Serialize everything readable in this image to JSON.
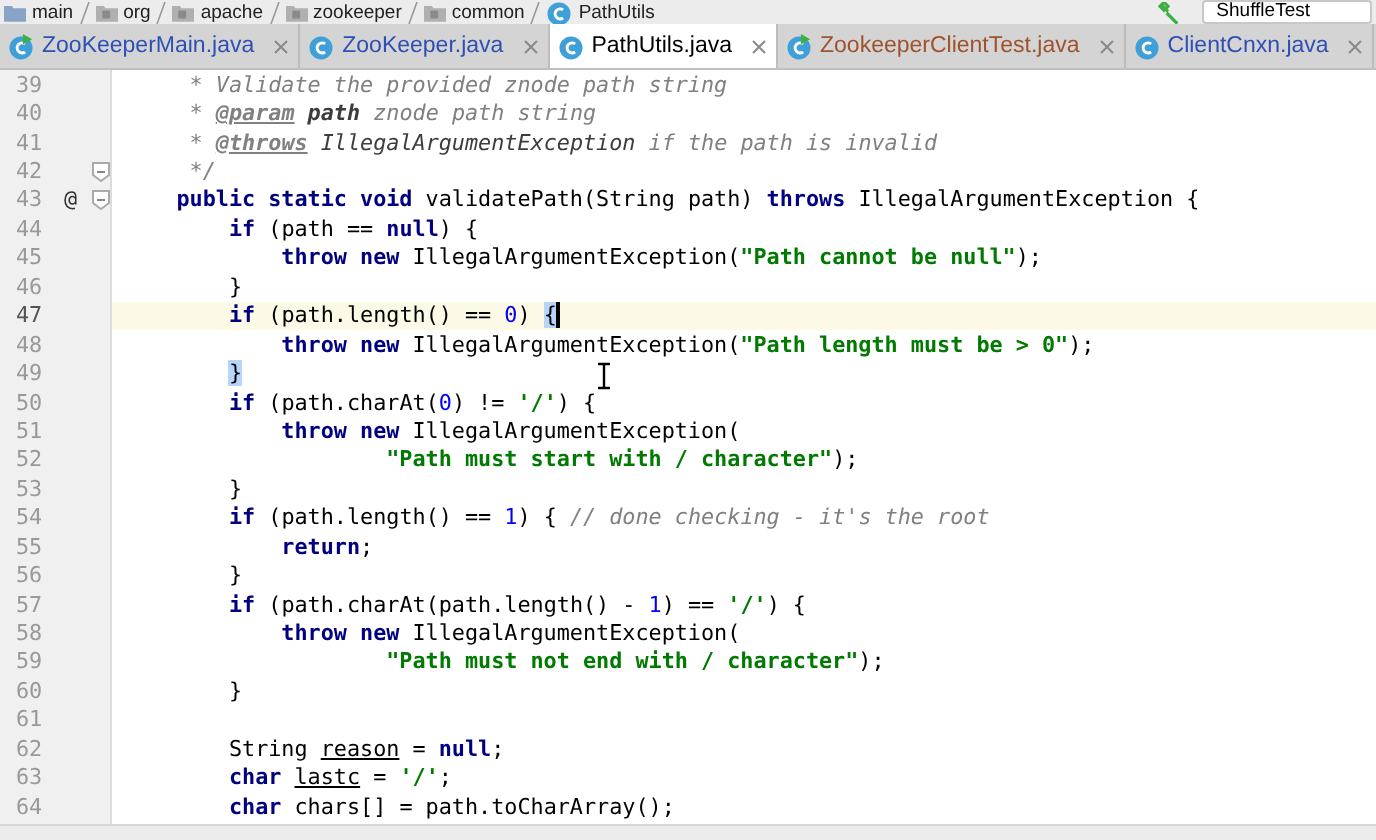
{
  "breadcrumbs": [
    {
      "label": "main",
      "kind": "folder"
    },
    {
      "label": "org",
      "kind": "package"
    },
    {
      "label": "apache",
      "kind": "package"
    },
    {
      "label": "zookeeper",
      "kind": "package"
    },
    {
      "label": "common",
      "kind": "package"
    },
    {
      "label": "PathUtils",
      "kind": "class"
    }
  ],
  "run_config": {
    "label": "ShuffleTest"
  },
  "tabs": [
    {
      "label": "ZooKeeperMain.java",
      "selected": false,
      "runnable": true,
      "color": "#2f4fb5"
    },
    {
      "label": "ZooKeeper.java",
      "selected": false,
      "runnable": false,
      "color": "#2f4fb5"
    },
    {
      "label": "PathUtils.java",
      "selected": true,
      "runnable": false,
      "color": "#000000"
    },
    {
      "label": "ZookeeperClientTest.java",
      "selected": false,
      "runnable": true,
      "color": "#a0522d"
    },
    {
      "label": "ClientCnxn.java",
      "selected": false,
      "runnable": false,
      "color": "#2f4fb5"
    }
  ],
  "lines": [
    {
      "number": "39",
      "current": false,
      "caret": false,
      "fold": false,
      "segments": [
        {
          "kind": "comment",
          "text": "* Validate the provided znode path string"
        }
      ]
    },
    {
      "number": "40",
      "current": false,
      "caret": false,
      "fold": false,
      "segments": [
        {
          "kind": "comment",
          "text": "* "
        },
        {
          "kind": "doctag",
          "text": "@param"
        },
        {
          "kind": "docparam",
          "text": " path"
        },
        {
          "kind": "comment",
          "text": " znode path string"
        }
      ]
    },
    {
      "number": "41",
      "current": false,
      "caret": false,
      "fold": false,
      "segments": [
        {
          "kind": "comment",
          "text": "* "
        },
        {
          "kind": "doctag",
          "text": "@throws"
        },
        {
          "kind": "doctype",
          "text": " IllegalArgumentException"
        },
        {
          "kind": "comment",
          "text": " if the path is invalid"
        }
      ]
    },
    {
      "number": "42",
      "current": false,
      "caret": false,
      "fold": true,
      "segments": [
        {
          "kind": "comment",
          "text": "*/"
        }
      ]
    },
    {
      "number": "43",
      "current": false,
      "caret": false,
      "fold": true,
      "mark": "@",
      "segments": [
        {
          "kind": "keyword",
          "text": "public static void"
        },
        {
          "kind": "plain",
          "text": " validatePath(String path) "
        },
        {
          "kind": "keyword",
          "text": "throws"
        },
        {
          "kind": "plain",
          "text": " IllegalArgumentException {"
        }
      ]
    },
    {
      "number": "44",
      "current": false,
      "caret": false,
      "fold": false,
      "segments": [
        {
          "kind": "keyword",
          "text": "if"
        },
        {
          "kind": "plain",
          "text": " (path == "
        },
        {
          "kind": "keyword",
          "text": "null"
        },
        {
          "kind": "plain",
          "text": ") {"
        }
      ]
    },
    {
      "number": "45",
      "current": false,
      "caret": false,
      "fold": false,
      "segments": [
        {
          "kind": "keyword",
          "text": "throw new"
        },
        {
          "kind": "plain",
          "text": " IllegalArgumentException("
        },
        {
          "kind": "string",
          "text": "\"Path cannot be null\""
        },
        {
          "kind": "plain",
          "text": ");"
        }
      ]
    },
    {
      "number": "46",
      "current": false,
      "caret": false,
      "fold": false,
      "segments": [
        {
          "kind": "plain",
          "text": "}"
        }
      ]
    },
    {
      "number": "47",
      "current": true,
      "caret": true,
      "fold": false,
      "segments": [
        {
          "kind": "keyword",
          "text": "if"
        },
        {
          "kind": "plain",
          "text": " (path.length() == "
        },
        {
          "kind": "number",
          "text": "0"
        },
        {
          "kind": "plain",
          "text": ") "
        },
        {
          "kind": "matched-brace",
          "text": "{"
        }
      ]
    },
    {
      "number": "48",
      "current": false,
      "caret": false,
      "fold": false,
      "segments": [
        {
          "kind": "keyword",
          "text": "throw new"
        },
        {
          "kind": "plain",
          "text": " IllegalArgumentException("
        },
        {
          "kind": "string",
          "text": "\"Path length must be > 0\""
        },
        {
          "kind": "plain",
          "text": ");"
        }
      ]
    },
    {
      "number": "49",
      "current": false,
      "caret": false,
      "fold": false,
      "segments": [
        {
          "kind": "matched-brace",
          "text": "}"
        }
      ]
    },
    {
      "number": "50",
      "current": false,
      "caret": false,
      "fold": false,
      "segments": [
        {
          "kind": "keyword",
          "text": "if"
        },
        {
          "kind": "plain",
          "text": " (path.charAt("
        },
        {
          "kind": "number",
          "text": "0"
        },
        {
          "kind": "plain",
          "text": ") != "
        },
        {
          "kind": "string",
          "text": "'/'"
        },
        {
          "kind": "plain",
          "text": ") {"
        }
      ]
    },
    {
      "number": "51",
      "current": false,
      "caret": false,
      "fold": false,
      "segments": [
        {
          "kind": "keyword",
          "text": "throw new"
        },
        {
          "kind": "plain",
          "text": " IllegalArgumentException("
        }
      ]
    },
    {
      "number": "52",
      "current": false,
      "caret": false,
      "fold": false,
      "segments": [
        {
          "kind": "string",
          "text": "\"Path must start with / character\""
        },
        {
          "kind": "plain",
          "text": ");"
        }
      ]
    },
    {
      "number": "53",
      "current": false,
      "caret": false,
      "fold": false,
      "segments": [
        {
          "kind": "plain",
          "text": "}"
        }
      ]
    },
    {
      "number": "54",
      "current": false,
      "caret": false,
      "fold": false,
      "segments": [
        {
          "kind": "keyword",
          "text": "if"
        },
        {
          "kind": "plain",
          "text": " (path.length() == "
        },
        {
          "kind": "number",
          "text": "1"
        },
        {
          "kind": "plain",
          "text": ") { "
        },
        {
          "kind": "comment",
          "text": "// done checking - it's the root"
        }
      ]
    },
    {
      "number": "55",
      "current": false,
      "caret": false,
      "fold": false,
      "segments": [
        {
          "kind": "keyword",
          "text": "return"
        },
        {
          "kind": "plain",
          "text": ";"
        }
      ]
    },
    {
      "number": "56",
      "current": false,
      "caret": false,
      "fold": false,
      "segments": [
        {
          "kind": "plain",
          "text": "}"
        }
      ]
    },
    {
      "number": "57",
      "current": false,
      "caret": false,
      "fold": false,
      "segments": [
        {
          "kind": "keyword",
          "text": "if"
        },
        {
          "kind": "plain",
          "text": " (path.charAt(path.length() - "
        },
        {
          "kind": "number",
          "text": "1"
        },
        {
          "kind": "plain",
          "text": ") == "
        },
        {
          "kind": "string",
          "text": "'/'"
        },
        {
          "kind": "plain",
          "text": ") {"
        }
      ]
    },
    {
      "number": "58",
      "current": false,
      "caret": false,
      "fold": false,
      "segments": [
        {
          "kind": "keyword",
          "text": "throw new"
        },
        {
          "kind": "plain",
          "text": " IllegalArgumentException("
        }
      ]
    },
    {
      "number": "59",
      "current": false,
      "caret": false,
      "fold": false,
      "segments": [
        {
          "kind": "string",
          "text": "\"Path must not end with / character\""
        },
        {
          "kind": "plain",
          "text": ");"
        }
      ]
    },
    {
      "number": "60",
      "current": false,
      "caret": false,
      "fold": false,
      "segments": [
        {
          "kind": "plain",
          "text": "}"
        }
      ]
    },
    {
      "number": "61",
      "current": false,
      "caret": false,
      "fold": false
    },
    {
      "number": "62",
      "current": false,
      "caret": false,
      "fold": false,
      "segments": [
        {
          "kind": "plain",
          "text": "String "
        },
        {
          "kind": "local",
          "text": "reason"
        },
        {
          "kind": "plain",
          "text": " = "
        },
        {
          "kind": "keyword",
          "text": "null"
        },
        {
          "kind": "plain",
          "text": ";"
        }
      ]
    },
    {
      "number": "63",
      "current": false,
      "caret": false,
      "fold": false,
      "segments": [
        {
          "kind": "keyword",
          "text": "char "
        },
        {
          "kind": "local",
          "text": "lastc"
        },
        {
          "kind": "plain",
          "text": " = "
        },
        {
          "kind": "string",
          "text": "'/'"
        },
        {
          "kind": "plain",
          "text": ";"
        }
      ]
    },
    {
      "number": "64",
      "current": false,
      "caret": false,
      "fold": false,
      "segments": [
        {
          "kind": "keyword",
          "text": "char"
        },
        {
          "kind": "plain",
          "text": " chars[] = path.toCharArray();"
        }
      ]
    }
  ]
}
